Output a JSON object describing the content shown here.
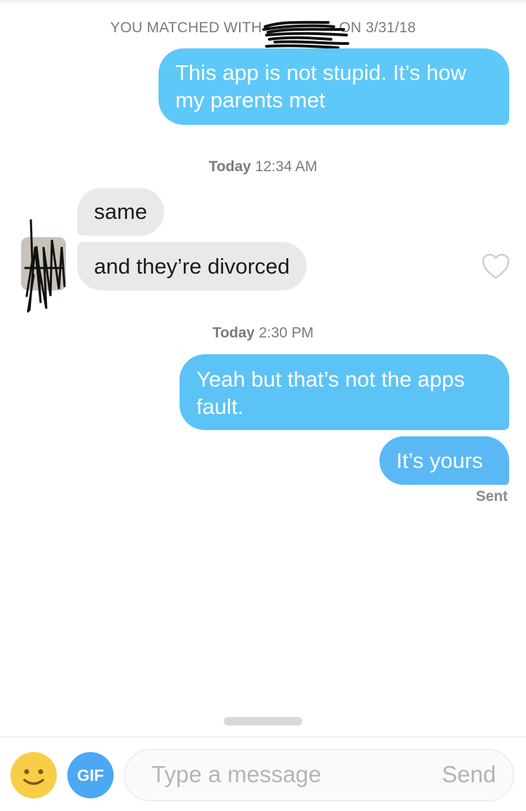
{
  "header": {
    "match_prefix": "YOU MATCHED WITH",
    "match_suffix": "ON 3/31/18"
  },
  "messages": [
    {
      "direction": "outgoing",
      "text": "This app is not stupid. It’s how my parents met"
    },
    {
      "direction": "incoming",
      "text": "same"
    },
    {
      "direction": "incoming",
      "text": "and they’re divorced"
    },
    {
      "direction": "outgoing",
      "text": "Yeah but that’s not the apps fault."
    },
    {
      "direction": "outgoing",
      "text": "It’s yours"
    }
  ],
  "timestamps": [
    {
      "day": "Today",
      "time": "12:34 AM"
    },
    {
      "day": "Today",
      "time": "2:30 PM"
    }
  ],
  "status": {
    "sent_label": "Sent"
  },
  "composer": {
    "placeholder": "Type a message",
    "send_label": "Send",
    "gif_label": "GIF",
    "emoji_icon": "smiley-icon"
  },
  "colors": {
    "outgoing_bubble": "#5ec8f8",
    "incoming_bubble": "#e9e9ea",
    "gif_button": "#4aa8f4",
    "emoji_button": "#f8ce47"
  }
}
